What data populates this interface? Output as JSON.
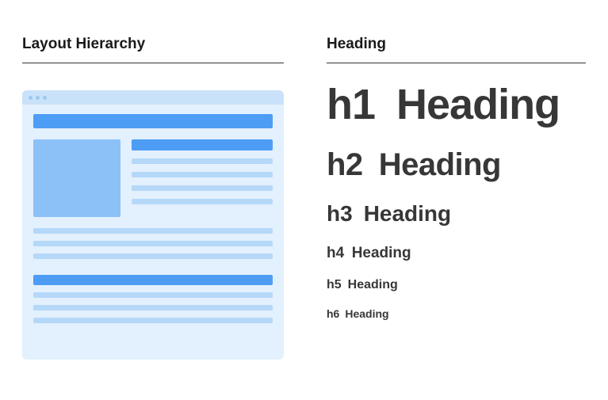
{
  "left": {
    "title": "Layout Hierarchy"
  },
  "right": {
    "title": "Heading",
    "headings": [
      {
        "tag": "h1",
        "label": "Heading"
      },
      {
        "tag": "h2",
        "label": "Heading"
      },
      {
        "tag": "h3",
        "label": "Heading"
      },
      {
        "tag": "h4",
        "label": "Heading"
      },
      {
        "tag": "h5",
        "label": "Heading"
      },
      {
        "tag": "h6",
        "label": "Heading"
      }
    ]
  }
}
